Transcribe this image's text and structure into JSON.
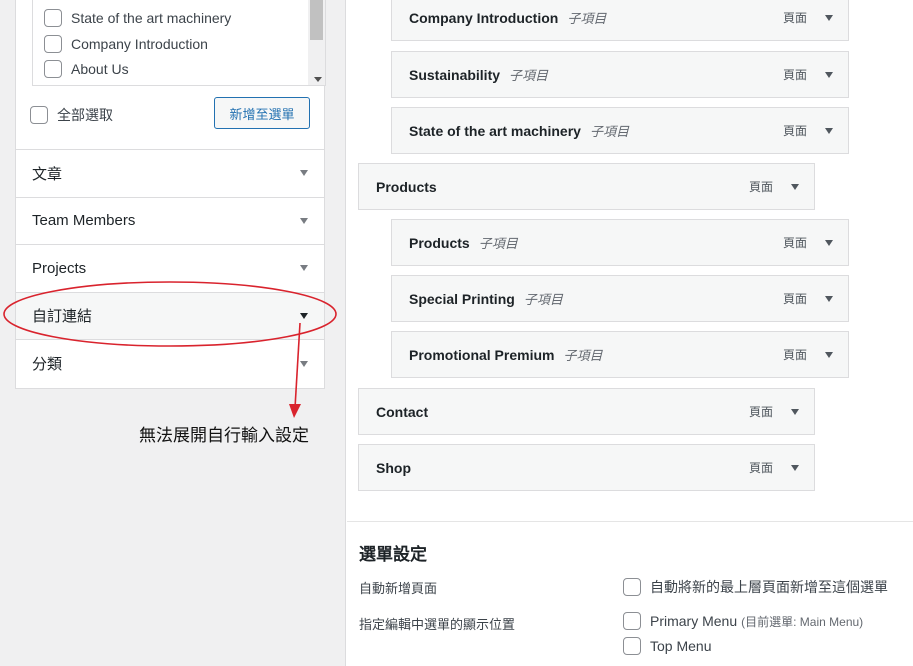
{
  "left_panel": {
    "page_items": [
      {
        "label": "State of the art machinery"
      },
      {
        "label": "Company Introduction"
      },
      {
        "label": "About Us"
      }
    ],
    "select_all_label": "全部選取",
    "add_to_menu_label": "新增至選單",
    "accordion": [
      {
        "label": "文章"
      },
      {
        "label": "Team Members"
      },
      {
        "label": "Projects"
      },
      {
        "label": "自訂連結"
      },
      {
        "label": "分類"
      }
    ]
  },
  "annotation": {
    "text": "無法展開自行輸入設定",
    "color": "#d9232d"
  },
  "menu_structure": {
    "sub_label": "子項目",
    "items": [
      {
        "title": "Company Introduction",
        "type": "頁面",
        "level": "sub"
      },
      {
        "title": "Sustainability",
        "type": "頁面",
        "level": "sub"
      },
      {
        "title": "State of the art machinery",
        "type": "頁面",
        "level": "sub"
      },
      {
        "title": "Products",
        "type": "頁面",
        "level": "top"
      },
      {
        "title": "Products",
        "type": "頁面",
        "level": "sub"
      },
      {
        "title": "Special Printing",
        "type": "頁面",
        "level": "sub"
      },
      {
        "title": "Promotional Premium",
        "type": "頁面",
        "level": "sub"
      },
      {
        "title": "Contact",
        "type": "頁面",
        "level": "top"
      },
      {
        "title": "Shop",
        "type": "頁面",
        "level": "top"
      }
    ]
  },
  "menu_settings": {
    "title": "選單設定",
    "auto_add_label": "自動新增頁面",
    "auto_add_option": "自動將新的最上層頁面新增至這個選單",
    "location_label": "指定編輯中選單的顯示位置",
    "locations": [
      {
        "label": "Primary Menu",
        "note": "(目前選單: Main Menu)"
      },
      {
        "label": "Top Menu",
        "note": ""
      }
    ]
  }
}
